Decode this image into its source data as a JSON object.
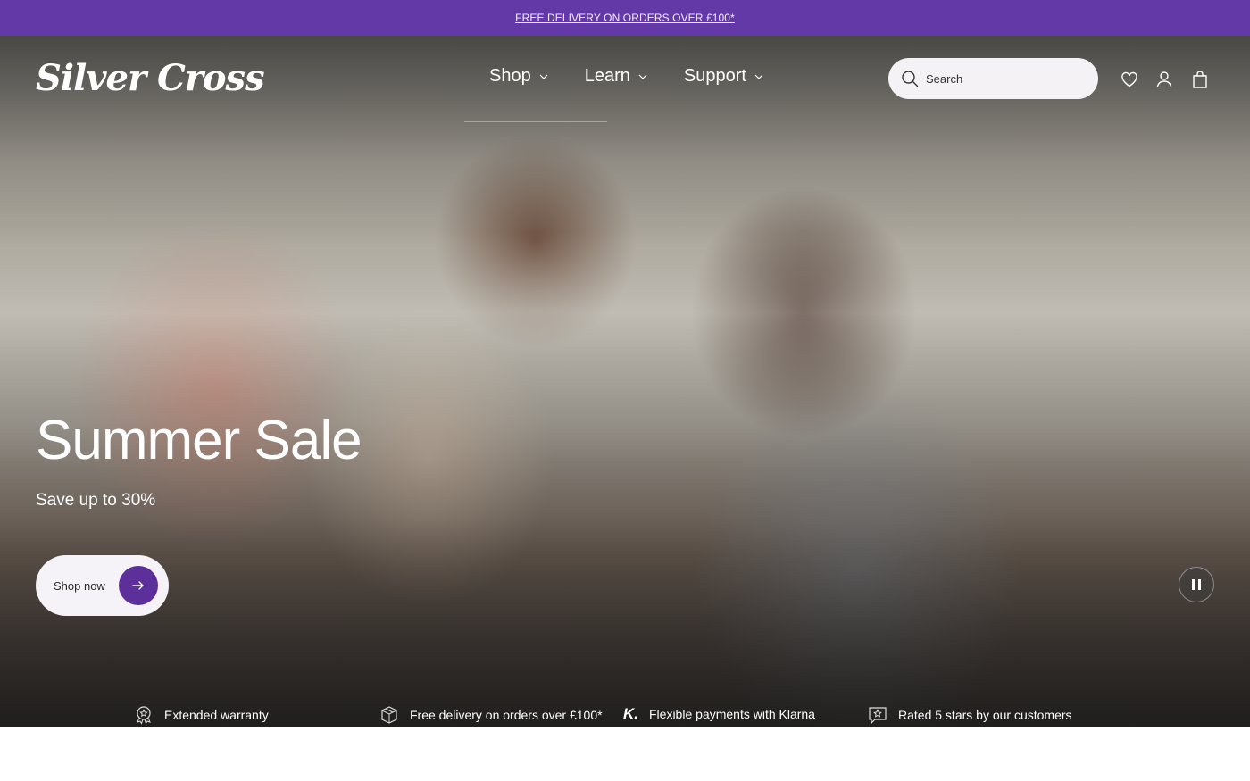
{
  "announcement": {
    "text": "FREE DELIVERY ON ORDERS OVER £100*"
  },
  "header": {
    "logo_text": "Silver Cross",
    "nav": [
      {
        "label": "Shop"
      },
      {
        "label": "Learn"
      },
      {
        "label": "Support"
      }
    ],
    "search": {
      "placeholder": "Search",
      "icon": "search-icon"
    },
    "icons": [
      "heart-icon",
      "user-icon",
      "bag-icon"
    ]
  },
  "hero": {
    "title": "Summer Sale",
    "subtitle": "Save up to 30%",
    "cta_label": "Shop now"
  },
  "usps": [
    {
      "label": "Extended warranty",
      "icon": "warranty-badge-icon"
    },
    {
      "label": "Free delivery on orders over £100*",
      "icon": "box-icon"
    },
    {
      "label": "Flexible payments with Klarna",
      "icon": "klarna-k",
      "glyph": "K."
    },
    {
      "label": "Rated 5 stars by our customers",
      "icon": "star-chat-icon"
    }
  ],
  "colors": {
    "brand_purple": "#6339a8",
    "cta_purple": "#5c2f9a"
  }
}
